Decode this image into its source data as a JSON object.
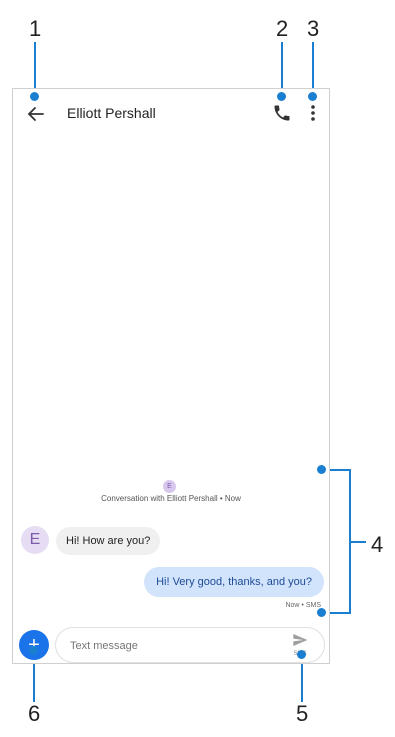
{
  "callouts": [
    "1",
    "2",
    "3",
    "4",
    "5",
    "6"
  ],
  "header": {
    "contact_name": "Elliott Pershall"
  },
  "conversation": {
    "avatar_initial": "E",
    "info": "Conversation with Elliott Pershall • Now"
  },
  "messages": {
    "incoming": {
      "avatar_initial": "E",
      "text": "Hi! How are you?"
    },
    "outgoing": {
      "text": "Hi! Very good, thanks, and you?",
      "meta": "Now • SMS"
    }
  },
  "compose": {
    "placeholder": "Text message",
    "send_label": "SMS",
    "attach_symbol": "+"
  },
  "colors": {
    "accent": "#1a73e8",
    "callout": "#1a7fd1",
    "outgoing_bubble": "#d2e3fc",
    "incoming_bubble": "#f0f0f0"
  },
  "icons": [
    "back-arrow-icon",
    "phone-icon",
    "more-vert-icon",
    "send-icon",
    "plus-icon"
  ]
}
